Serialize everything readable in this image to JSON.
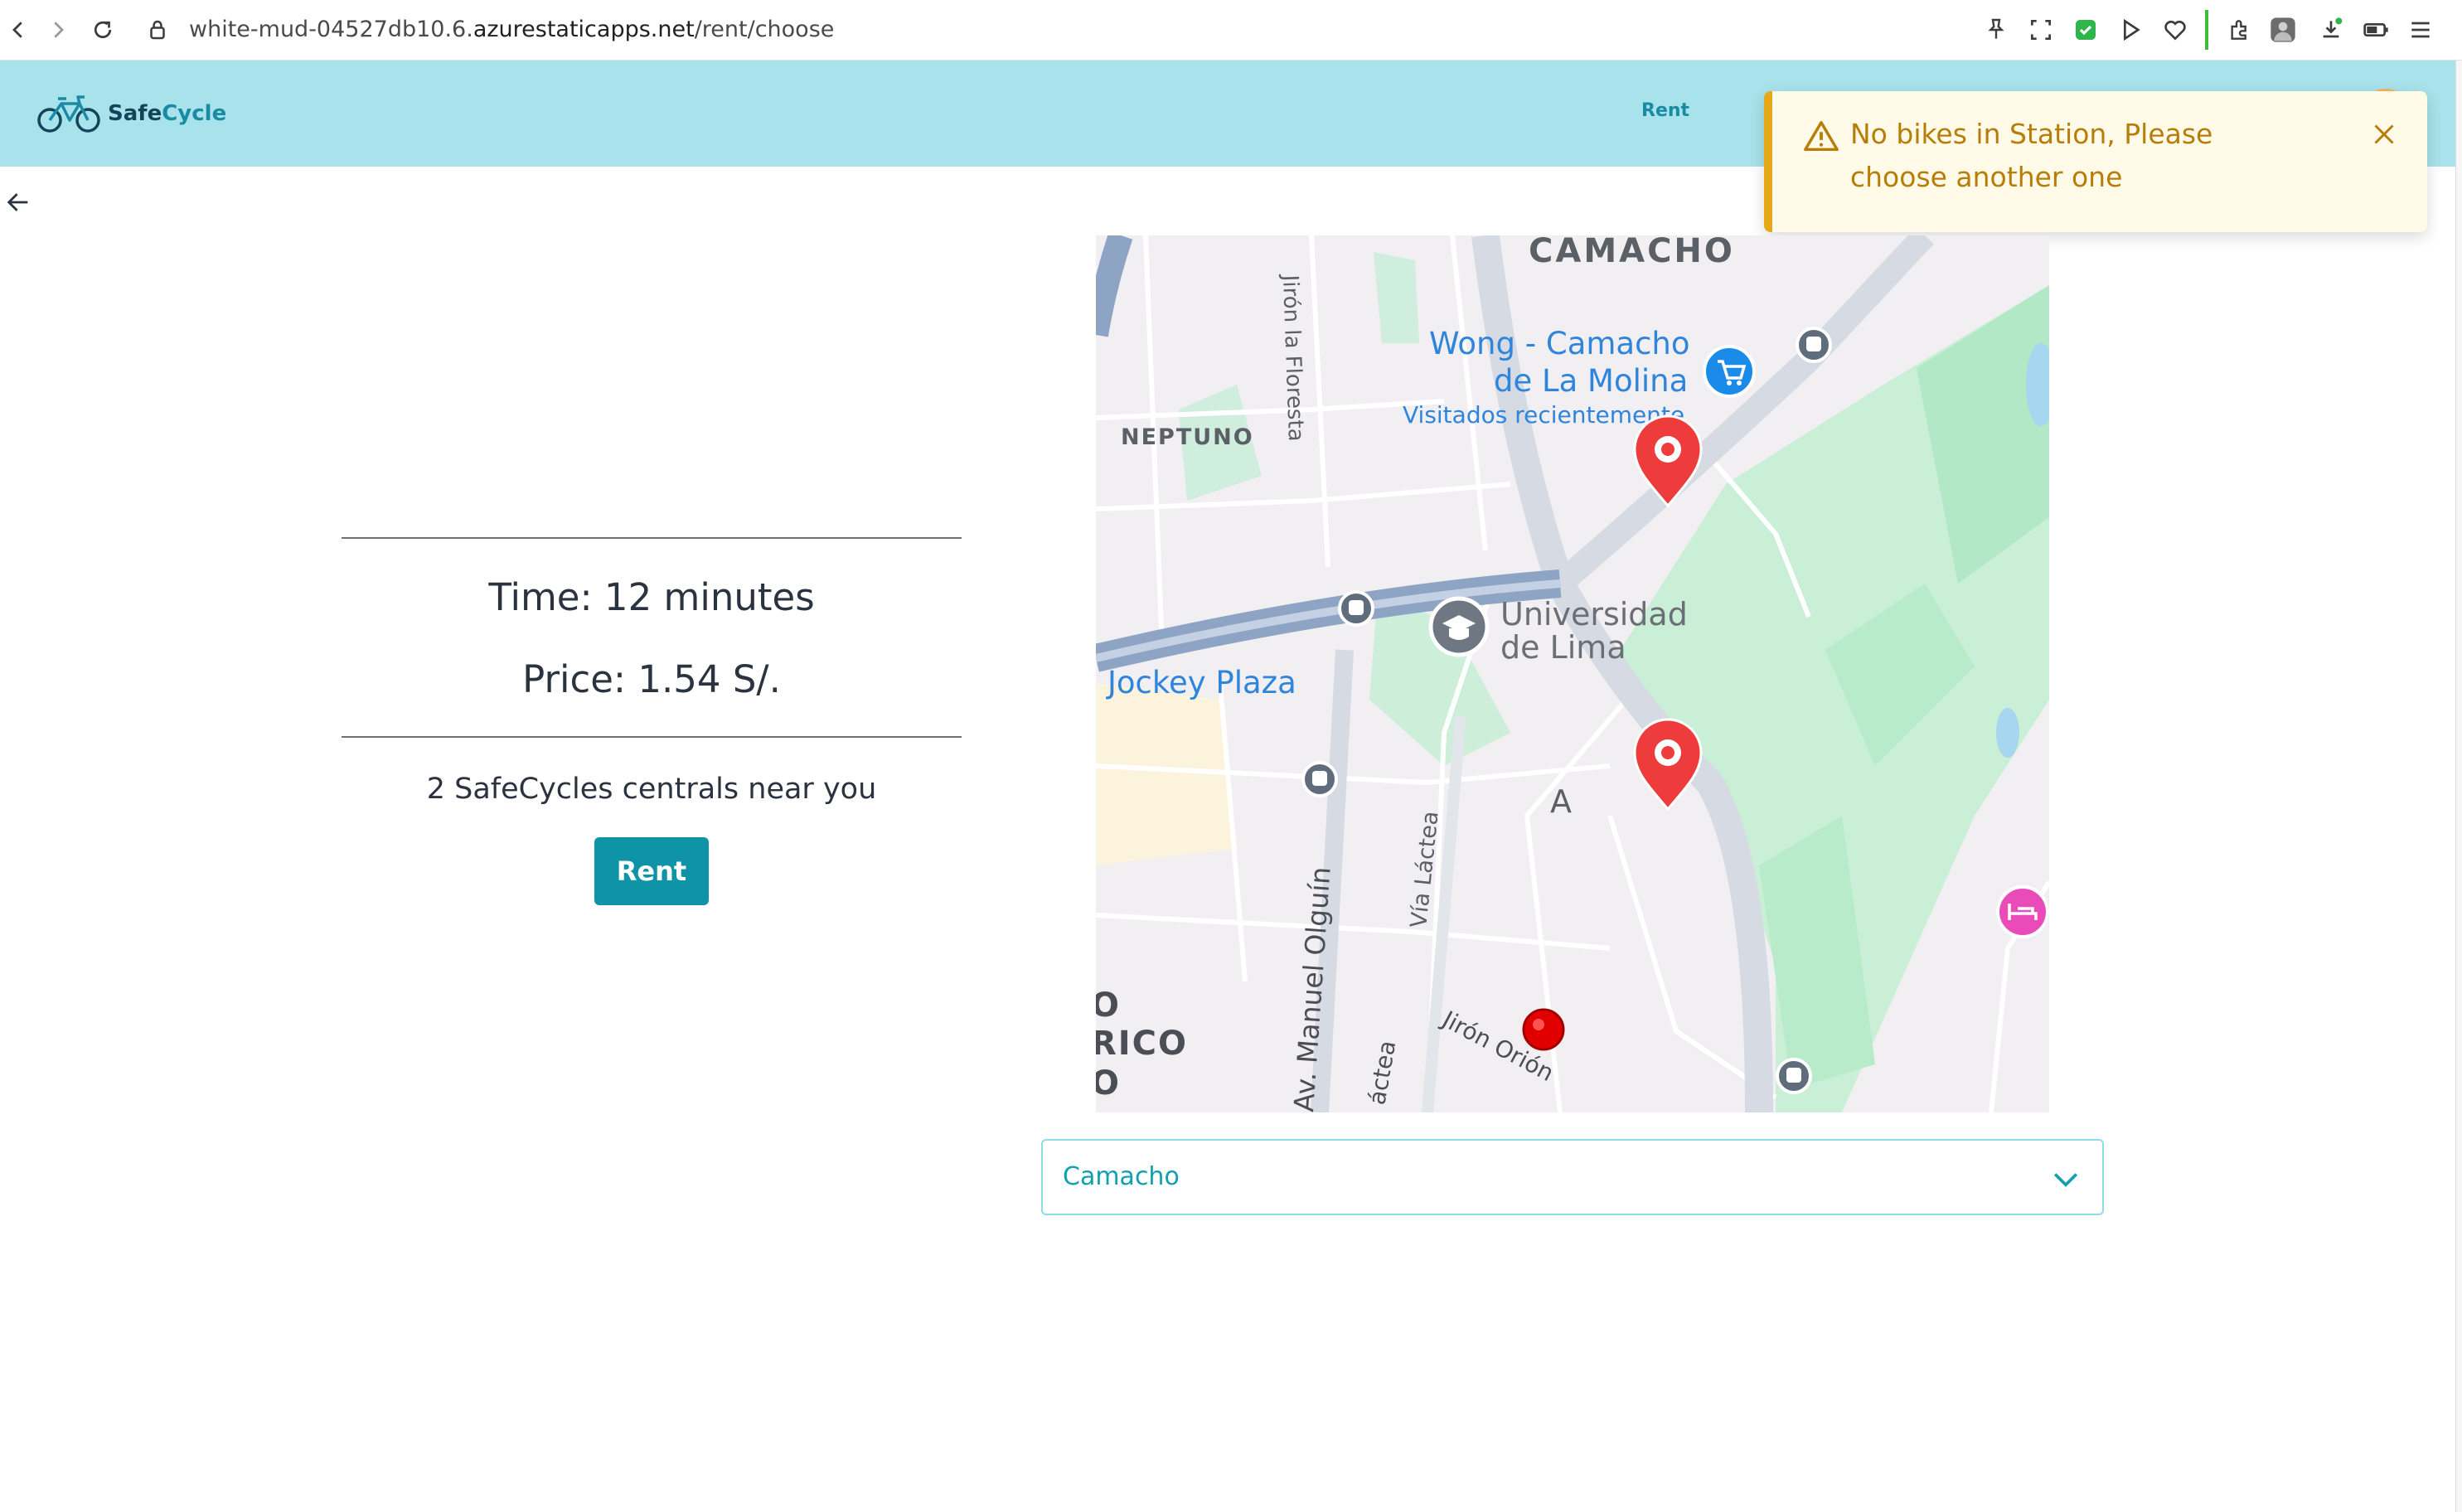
{
  "browser": {
    "url_prefix": "white-mud-04527db10.6.",
    "url_host": "azurestaticapps.net",
    "url_path": "/rent/choose"
  },
  "header": {
    "logo_part1": "Safe",
    "logo_part2": "Cycle",
    "nav_rent": "Rent"
  },
  "toast": {
    "message": "No bikes in Station, Please choose another one",
    "color": "#e6a817"
  },
  "rental": {
    "time_text": "Time: 12 minutes",
    "price_text": "Price: 1.54 S/.",
    "near_text": "2 SafeCycles centrals near you",
    "rent_button": "Rent"
  },
  "map": {
    "labels": {
      "camacho": "CAMACHO",
      "wong1": "Wong - Camacho",
      "wong2": "de La Molina",
      "visited": "Visitados recientemente",
      "neptuno": "NEPTUNO",
      "floresta": "Jirón la Floresta",
      "univ1": "Universidad",
      "univ2": "de Lima",
      "jockey": "Jockey Plaza",
      "a": "A",
      "lactea": "Vía Láctea",
      "olguin": "Av. Manuel Olguín",
      "orion": "Jirón Orión",
      "rico1": "O",
      "rico2": "RICO",
      "rico3": "O",
      "actea": "áctea"
    }
  },
  "station_select": {
    "selected": "Camacho"
  },
  "colors": {
    "header_bg": "#a8e2ea",
    "accent": "#0f93a7",
    "pin": "#ee3b3b"
  }
}
